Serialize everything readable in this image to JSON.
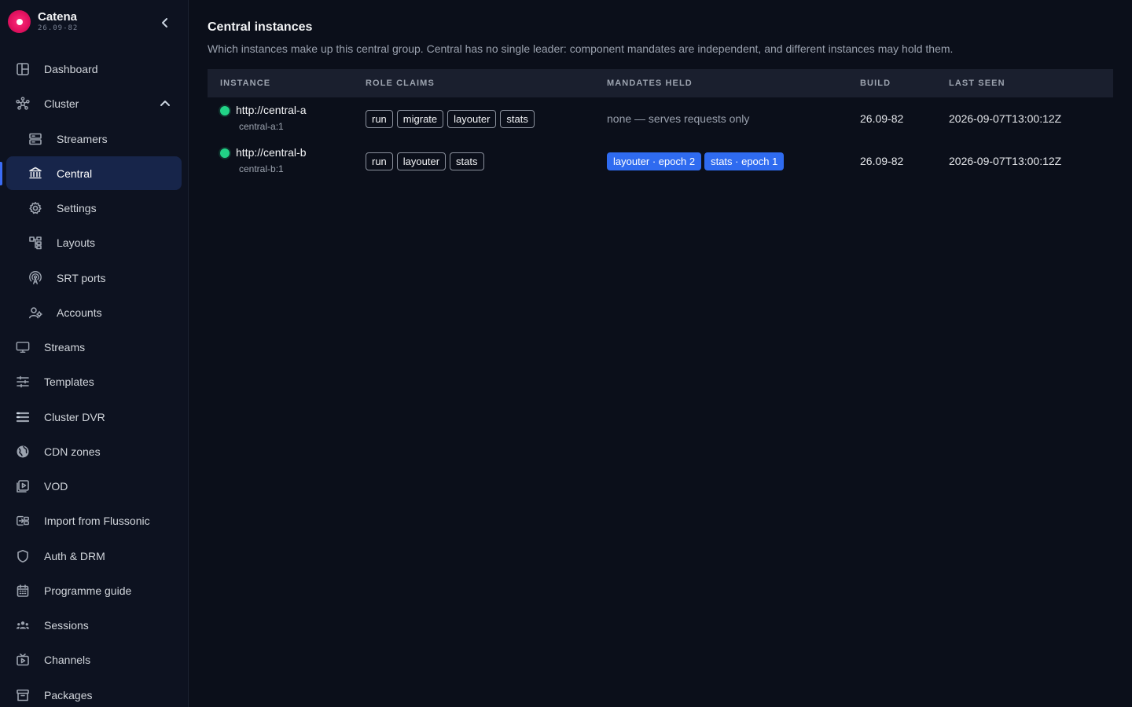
{
  "app": {
    "name": "Catena",
    "version": "26.09-82"
  },
  "sidebar": {
    "items": [
      {
        "label": "Dashboard",
        "icon": "dashboard-icon"
      },
      {
        "label": "Cluster",
        "icon": "cluster-icon",
        "expanded": true
      },
      {
        "label": "Streamers",
        "icon": "server-icon"
      },
      {
        "label": "Central",
        "icon": "bank-icon",
        "active": true
      },
      {
        "label": "Settings",
        "icon": "gear-icon"
      },
      {
        "label": "Layouts",
        "icon": "layouts-icon"
      },
      {
        "label": "SRT ports",
        "icon": "antenna-icon"
      },
      {
        "label": "Accounts",
        "icon": "accounts-icon"
      },
      {
        "label": "Streams",
        "icon": "monitor-icon"
      },
      {
        "label": "Templates",
        "icon": "sliders-icon"
      },
      {
        "label": "Cluster DVR",
        "icon": "storage-icon"
      },
      {
        "label": "CDN zones",
        "icon": "globe-icon"
      },
      {
        "label": "VOD",
        "icon": "video-library-icon"
      },
      {
        "label": "Import from Flussonic",
        "icon": "import-icon"
      },
      {
        "label": "Auth & DRM",
        "icon": "shield-icon"
      },
      {
        "label": "Programme guide",
        "icon": "calendar-icon"
      },
      {
        "label": "Sessions",
        "icon": "users-icon"
      },
      {
        "label": "Channels",
        "icon": "tv-icon"
      },
      {
        "label": "Packages",
        "icon": "archive-icon"
      }
    ]
  },
  "main": {
    "title": "Central instances",
    "subtitle": "Which instances make up this central group. Central has no single leader: component mandates are independent, and different instances may hold them.",
    "columns": [
      "INSTANCE",
      "ROLE CLAIMS",
      "MANDATES HELD",
      "BUILD",
      "LAST SEEN"
    ],
    "rows": [
      {
        "status_color": "#22d387",
        "url": "http://central-a",
        "id": "central-a:1",
        "roles": [
          "run",
          "migrate",
          "layouter",
          "stats"
        ],
        "mandates_text": "none — serves requests only",
        "mandates": [],
        "build": "26.09-82",
        "last_seen": "2026-09-07T13:00:12Z"
      },
      {
        "status_color": "#22d387",
        "url": "http://central-b",
        "id": "central-b:1",
        "roles": [
          "run",
          "layouter",
          "stats"
        ],
        "mandates_text": "",
        "mandates": [
          "layouter · epoch 2",
          "stats · epoch 1"
        ],
        "build": "26.09-82",
        "last_seen": "2026-09-07T13:00:12Z"
      }
    ]
  },
  "colors": {
    "accent": "#2f6bf0",
    "active_bg": "#17254a",
    "brand": "#e0115f",
    "status_ok": "#22d387"
  }
}
